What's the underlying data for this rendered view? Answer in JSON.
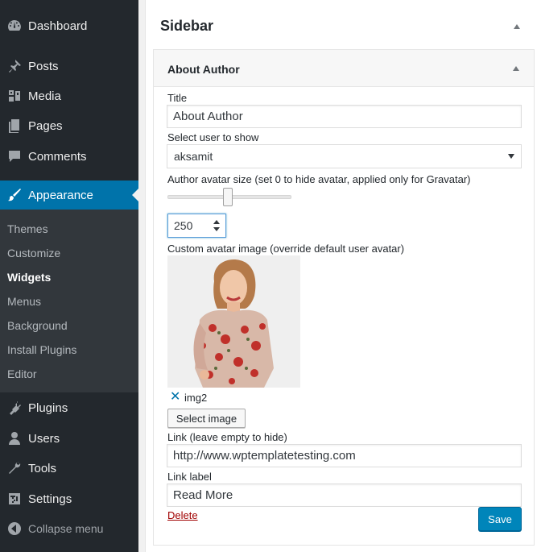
{
  "admin_menu": {
    "items": [
      {
        "label": "Dashboard",
        "icon": "dashboard-icon"
      },
      {
        "label": "Posts",
        "icon": "pin-icon"
      },
      {
        "label": "Media",
        "icon": "media-icon"
      },
      {
        "label": "Pages",
        "icon": "pages-icon"
      },
      {
        "label": "Comments",
        "icon": "comment-icon"
      },
      {
        "label": "Appearance",
        "icon": "paintbrush-icon"
      },
      {
        "label": "Plugins",
        "icon": "plugin-icon"
      },
      {
        "label": "Users",
        "icon": "user-icon"
      },
      {
        "label": "Tools",
        "icon": "wrench-icon"
      },
      {
        "label": "Settings",
        "icon": "settings-icon"
      }
    ],
    "submenu": [
      "Themes",
      "Customize",
      "Widgets",
      "Menus",
      "Background",
      "Install Plugins",
      "Editor"
    ],
    "collapse_label": "Collapse menu"
  },
  "sidebar": {
    "title": "Sidebar"
  },
  "widget": {
    "title": "About Author",
    "title_label": "Title",
    "title_value": "About Author",
    "user_label": "Select user to show",
    "user_value": "aksamit",
    "avatar_size_label": "Author avatar size (set 0 to hide avatar, applied only for Gravatar)",
    "avatar_size_value": "250",
    "custom_avatar_label": "Custom avatar image (override default user avatar)",
    "image_name": "img2",
    "select_image_label": "Select image",
    "link_label_text": "Link (leave empty to hide)",
    "link_value": "http://www.wptemplatetesting.com",
    "link_label_field_label": "Link label",
    "link_label_value": "Read More",
    "delete_label": "Delete",
    "save_label": "Save"
  },
  "colors": {
    "admin_bg": "#23282d",
    "submenu_bg": "#32373c",
    "accent": "#0073aa",
    "primary_button": "#0085ba",
    "delete_red": "#a00000"
  }
}
